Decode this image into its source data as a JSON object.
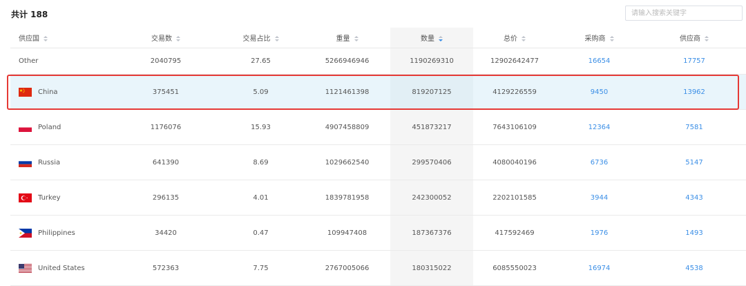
{
  "summary": {
    "total_label": "共计 188"
  },
  "search": {
    "placeholder": "请输入搜索关键字"
  },
  "table": {
    "columns": [
      {
        "label": "供应国",
        "sort": "none"
      },
      {
        "label": "交易数",
        "sort": "none"
      },
      {
        "label": "交易占比",
        "sort": "none"
      },
      {
        "label": "重量",
        "sort": "none"
      },
      {
        "label": "数量",
        "sort": "desc"
      },
      {
        "label": "总价",
        "sort": "none"
      },
      {
        "label": "采购商",
        "sort": "none"
      },
      {
        "label": "供应商",
        "sort": "none"
      }
    ],
    "rows": [
      {
        "country": "Other",
        "flag": "none",
        "transactions": "2040795",
        "share": "27.65",
        "weight": "5266946946",
        "quantity": "1190269310",
        "total_price": "12902642477",
        "buyers": "16654",
        "suppliers": "17757"
      },
      {
        "country": "China",
        "flag": "china-flag-icon",
        "transactions": "375451",
        "share": "5.09",
        "weight": "1121461398",
        "quantity": "819207125",
        "total_price": "4129226559",
        "buyers": "9450",
        "suppliers": "13962",
        "highlighted": true
      },
      {
        "country": "Poland",
        "flag": "poland-flag-icon",
        "transactions": "1176076",
        "share": "15.93",
        "weight": "4907458809",
        "quantity": "451873217",
        "total_price": "7643106109",
        "buyers": "12364",
        "suppliers": "7581"
      },
      {
        "country": "Russia",
        "flag": "russia-flag-icon",
        "transactions": "641390",
        "share": "8.69",
        "weight": "1029662540",
        "quantity": "299570406",
        "total_price": "4080040196",
        "buyers": "6736",
        "suppliers": "5147"
      },
      {
        "country": "Turkey",
        "flag": "turkey-flag-icon",
        "transactions": "296135",
        "share": "4.01",
        "weight": "1839781958",
        "quantity": "242300052",
        "total_price": "2202101585",
        "buyers": "3944",
        "suppliers": "4343"
      },
      {
        "country": "Philippines",
        "flag": "philippines-flag-icon",
        "transactions": "34420",
        "share": "0.47",
        "weight": "109947408",
        "quantity": "187367376",
        "total_price": "417592469",
        "buyers": "1976",
        "suppliers": "1493"
      },
      {
        "country": "United States",
        "flag": "usa-flag-icon",
        "transactions": "572363",
        "share": "7.75",
        "weight": "2767005066",
        "quantity": "180315022",
        "total_price": "6085550023",
        "buyers": "16974",
        "suppliers": "4538"
      }
    ]
  },
  "colors": {
    "link": "#3a8ee6",
    "highlight_border": "#e53935",
    "highlight_row": "#e9f5fb"
  }
}
